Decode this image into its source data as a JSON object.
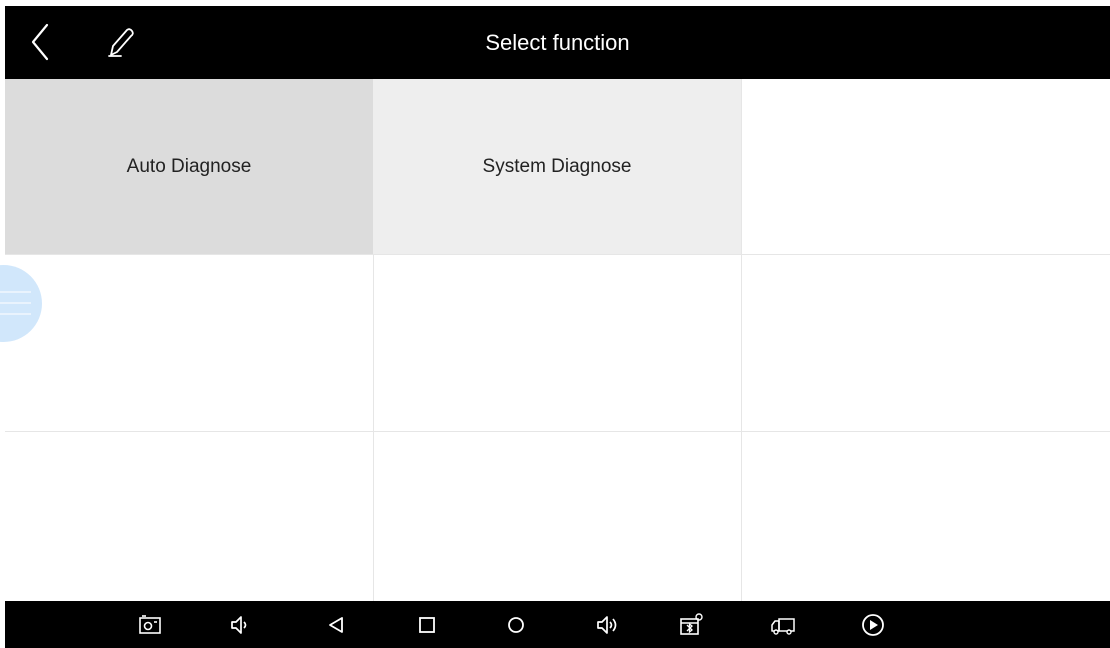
{
  "header": {
    "title": "Select function",
    "back_icon": "chevron-left-icon",
    "edit_icon": "pen-icon"
  },
  "grid": {
    "cells": [
      {
        "label": "Auto Diagnose"
      },
      {
        "label": "System Diagnose"
      },
      {
        "label": ""
      },
      {
        "label": ""
      },
      {
        "label": ""
      },
      {
        "label": ""
      },
      {
        "label": ""
      },
      {
        "label": ""
      },
      {
        "label": ""
      }
    ]
  },
  "floating_button": {
    "icon": "menu-lines-icon"
  },
  "navbar": {
    "icons": [
      "screenshot-icon",
      "volume-down-icon",
      "back-triangle-icon",
      "recent-apps-square-icon",
      "home-circle-icon",
      "volume-up-icon",
      "vci-connection-icon",
      "truck-icon",
      "play-circle-icon"
    ]
  },
  "colors": {
    "bar": "#000000",
    "selected_cell": "#dcdcdc",
    "second_cell": "#eeeeee",
    "grid_line": "#e6e6e6",
    "bubble": "#cfe6fb"
  }
}
